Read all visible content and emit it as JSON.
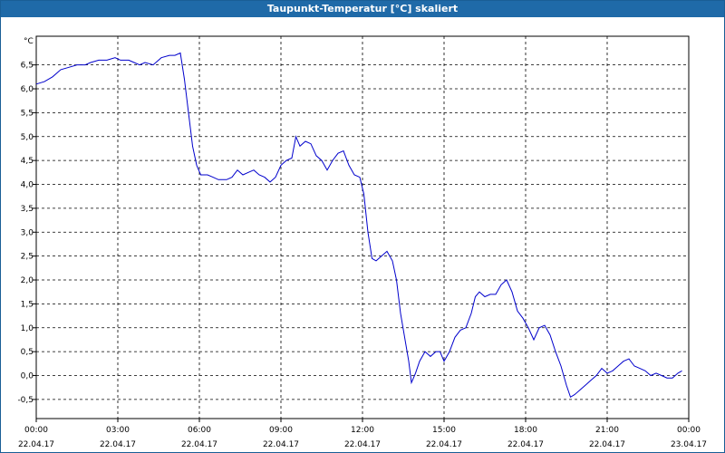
{
  "window": {
    "title": "Taupunkt-Temperatur [°C] skaliert"
  },
  "chart_data": {
    "type": "line",
    "title": "Taupunkt-Temperatur [°C] skaliert",
    "ylabel": "°C",
    "xlabel": "",
    "ylim": [
      -0.9,
      7.1
    ],
    "grid": true,
    "y_ticks": [
      -0.5,
      0.0,
      0.5,
      1.0,
      1.5,
      2.0,
      2.5,
      3.0,
      3.5,
      4.0,
      4.5,
      5.0,
      5.5,
      6.0,
      6.5
    ],
    "y_tick_labels": [
      "-0,5",
      "0,0",
      "0,5",
      "1,0",
      "1,5",
      "2,0",
      "2,5",
      "3,0",
      "3,5",
      "4,0",
      "4,5",
      "5,0",
      "5,5",
      "6,0",
      "6,5"
    ],
    "x_ticks": [
      {
        "time": "00:00",
        "date": "22.04.17"
      },
      {
        "time": "03:00",
        "date": "22.04.17"
      },
      {
        "time": "06:00",
        "date": "22.04.17"
      },
      {
        "time": "09:00",
        "date": "22.04.17"
      },
      {
        "time": "12:00",
        "date": "22.04.17"
      },
      {
        "time": "15:00",
        "date": "22.04.17"
      },
      {
        "time": "18:00",
        "date": "22.04.17"
      },
      {
        "time": "21:00",
        "date": "22.04.17"
      },
      {
        "time": "00:00",
        "date": "23.04.17"
      }
    ],
    "x_range_hours": [
      0,
      24
    ],
    "series": [
      {
        "color": "#0000cc",
        "points": [
          [
            0.0,
            6.1
          ],
          [
            0.3,
            6.15
          ],
          [
            0.6,
            6.25
          ],
          [
            0.9,
            6.4
          ],
          [
            1.2,
            6.45
          ],
          [
            1.5,
            6.5
          ],
          [
            1.8,
            6.5
          ],
          [
            2.0,
            6.55
          ],
          [
            2.3,
            6.6
          ],
          [
            2.6,
            6.6
          ],
          [
            2.9,
            6.65
          ],
          [
            3.1,
            6.6
          ],
          [
            3.4,
            6.6
          ],
          [
            3.6,
            6.55
          ],
          [
            3.8,
            6.5
          ],
          [
            4.0,
            6.55
          ],
          [
            4.3,
            6.5
          ],
          [
            4.6,
            6.65
          ],
          [
            4.9,
            6.7
          ],
          [
            5.1,
            6.7
          ],
          [
            5.3,
            6.75
          ],
          [
            5.45,
            6.2
          ],
          [
            5.6,
            5.5
          ],
          [
            5.75,
            4.8
          ],
          [
            5.9,
            4.4
          ],
          [
            6.05,
            4.2
          ],
          [
            6.3,
            4.2
          ],
          [
            6.5,
            4.15
          ],
          [
            6.7,
            4.1
          ],
          [
            7.0,
            4.1
          ],
          [
            7.2,
            4.15
          ],
          [
            7.4,
            4.3
          ],
          [
            7.6,
            4.2
          ],
          [
            7.8,
            4.25
          ],
          [
            8.0,
            4.3
          ],
          [
            8.2,
            4.2
          ],
          [
            8.4,
            4.15
          ],
          [
            8.6,
            4.05
          ],
          [
            8.8,
            4.15
          ],
          [
            9.0,
            4.4
          ],
          [
            9.2,
            4.5
          ],
          [
            9.4,
            4.55
          ],
          [
            9.55,
            5.0
          ],
          [
            9.7,
            4.8
          ],
          [
            9.9,
            4.9
          ],
          [
            10.1,
            4.85
          ],
          [
            10.3,
            4.6
          ],
          [
            10.5,
            4.5
          ],
          [
            10.7,
            4.3
          ],
          [
            10.9,
            4.5
          ],
          [
            11.1,
            4.65
          ],
          [
            11.3,
            4.7
          ],
          [
            11.5,
            4.4
          ],
          [
            11.7,
            4.2
          ],
          [
            11.9,
            4.15
          ],
          [
            12.05,
            3.8
          ],
          [
            12.2,
            3.0
          ],
          [
            12.35,
            2.45
          ],
          [
            12.5,
            2.4
          ],
          [
            12.7,
            2.5
          ],
          [
            12.9,
            2.6
          ],
          [
            13.1,
            2.4
          ],
          [
            13.25,
            2.0
          ],
          [
            13.4,
            1.3
          ],
          [
            13.55,
            0.8
          ],
          [
            13.7,
            0.3
          ],
          [
            13.8,
            -0.15
          ],
          [
            13.95,
            0.05
          ],
          [
            14.1,
            0.3
          ],
          [
            14.3,
            0.5
          ],
          [
            14.5,
            0.4
          ],
          [
            14.7,
            0.5
          ],
          [
            14.85,
            0.5
          ],
          [
            15.0,
            0.3
          ],
          [
            15.2,
            0.5
          ],
          [
            15.4,
            0.8
          ],
          [
            15.6,
            0.95
          ],
          [
            15.8,
            1.0
          ],
          [
            16.0,
            1.3
          ],
          [
            16.15,
            1.65
          ],
          [
            16.3,
            1.75
          ],
          [
            16.5,
            1.65
          ],
          [
            16.7,
            1.7
          ],
          [
            16.9,
            1.7
          ],
          [
            17.1,
            1.9
          ],
          [
            17.3,
            2.0
          ],
          [
            17.5,
            1.75
          ],
          [
            17.7,
            1.35
          ],
          [
            17.9,
            1.2
          ],
          [
            18.1,
            1.0
          ],
          [
            18.3,
            0.75
          ],
          [
            18.5,
            1.0
          ],
          [
            18.7,
            1.05
          ],
          [
            18.9,
            0.85
          ],
          [
            19.1,
            0.5
          ],
          [
            19.3,
            0.2
          ],
          [
            19.5,
            -0.2
          ],
          [
            19.65,
            -0.45
          ],
          [
            19.8,
            -0.4
          ],
          [
            20.0,
            -0.3
          ],
          [
            20.2,
            -0.2
          ],
          [
            20.4,
            -0.1
          ],
          [
            20.6,
            0.0
          ],
          [
            20.8,
            0.15
          ],
          [
            21.0,
            0.05
          ],
          [
            21.2,
            0.1
          ],
          [
            21.4,
            0.2
          ],
          [
            21.6,
            0.3
          ],
          [
            21.8,
            0.35
          ],
          [
            22.0,
            0.2
          ],
          [
            22.2,
            0.15
          ],
          [
            22.4,
            0.1
          ],
          [
            22.6,
            0.0
          ],
          [
            22.8,
            0.05
          ],
          [
            23.0,
            0.0
          ],
          [
            23.2,
            -0.05
          ],
          [
            23.4,
            -0.05
          ],
          [
            23.6,
            0.05
          ],
          [
            23.75,
            0.1
          ]
        ]
      }
    ]
  }
}
